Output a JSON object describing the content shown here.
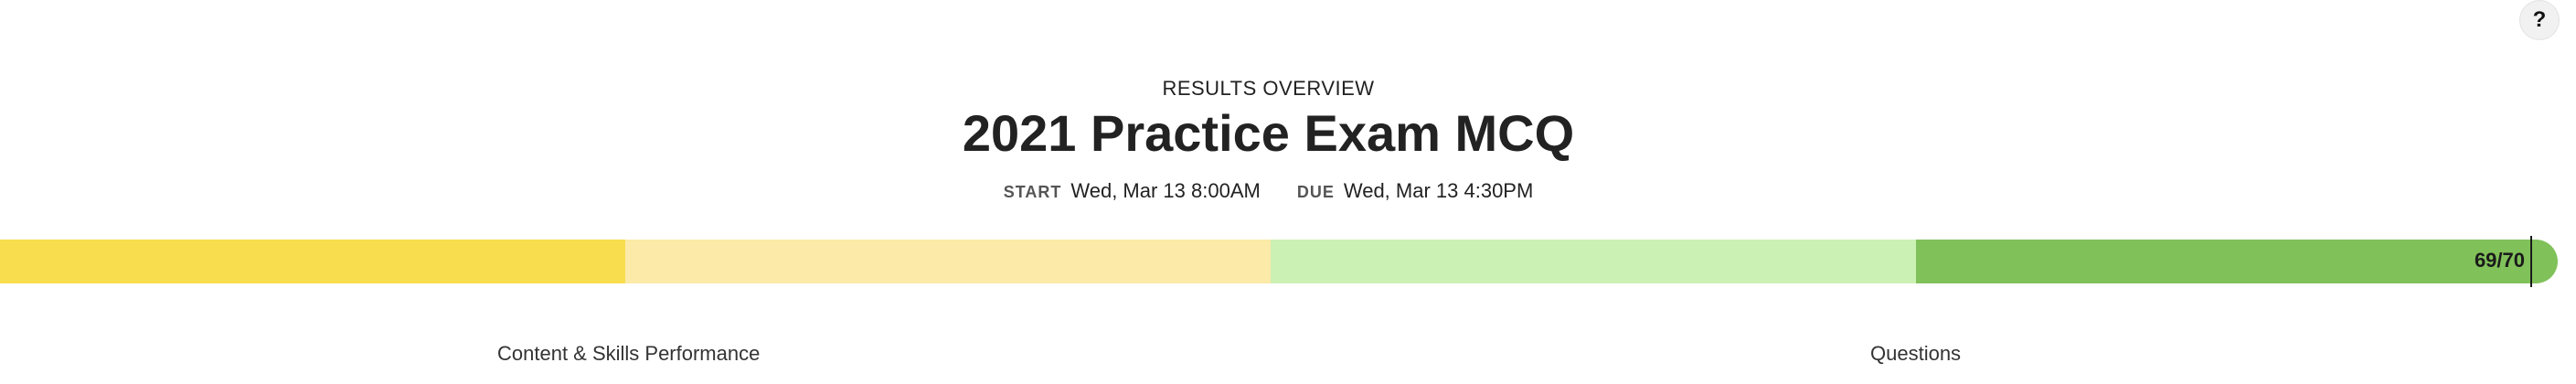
{
  "help": {
    "label": "?"
  },
  "header": {
    "overview_label": "RESULTS OVERVIEW",
    "title": "2021 Practice Exam MCQ"
  },
  "dates": {
    "start_label": "START",
    "start_value": "Wed, Mar 13 8:00AM",
    "due_label": "DUE",
    "due_value": "Wed, Mar 13 4:30PM"
  },
  "score": {
    "text": "69/70",
    "earned": 69,
    "total": 70,
    "band_colors": [
      "#f8dd4e",
      "#fbeaa8",
      "#ccf1b4",
      "#80c15a"
    ]
  },
  "sections": {
    "content_heading": "Content & Skills Performance",
    "questions_heading": "Questions"
  }
}
